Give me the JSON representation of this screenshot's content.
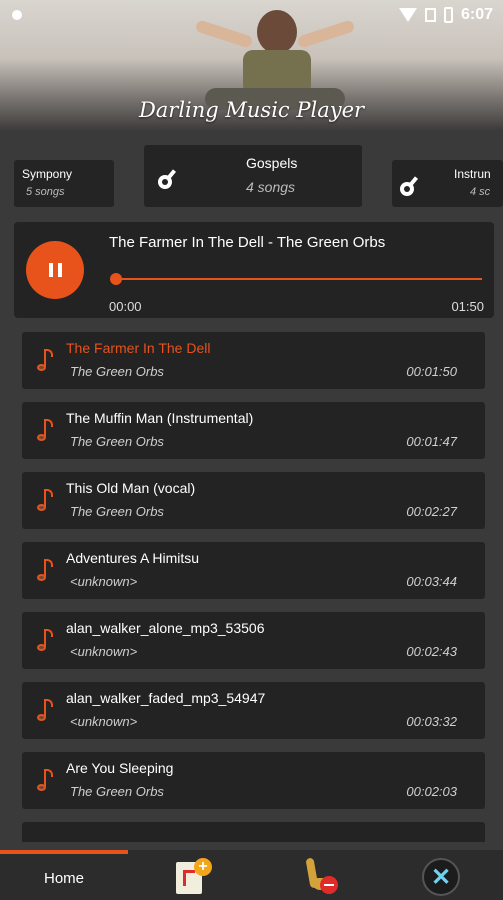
{
  "status_bar": {
    "time": "6:07"
  },
  "header": {
    "app_title": "Darling Music Player"
  },
  "playlists": [
    {
      "name": "Sympony",
      "count": "5 songs"
    },
    {
      "name": "Gospels",
      "count": "4 songs"
    },
    {
      "name": "Instrun",
      "count": "4 sc"
    }
  ],
  "now_playing": {
    "title": "The Farmer In The Dell - The Green Orbs",
    "current_time": "00:00",
    "duration": "01:50",
    "progress": 0.0
  },
  "songs": [
    {
      "title": "The Farmer In The Dell",
      "artist": "The Green Orbs",
      "duration": "00:01:50",
      "active": true
    },
    {
      "title": "The Muffin Man (Instrumental)",
      "artist": "The Green Orbs",
      "duration": "00:01:47"
    },
    {
      "title": "This Old Man (vocal)",
      "artist": "The Green Orbs",
      "duration": "00:02:27"
    },
    {
      "title": "Adventures A Himitsu",
      "artist": "<unknown>",
      "duration": "00:03:44"
    },
    {
      "title": "alan_walker_alone_mp3_53506",
      "artist": "<unknown>",
      "duration": "00:02:43"
    },
    {
      "title": "alan_walker_faded_mp3_54947",
      "artist": "<unknown>",
      "duration": "00:03:32"
    },
    {
      "title": "Are You Sleeping",
      "artist": "The Green Orbs",
      "duration": "00:02:03"
    }
  ],
  "bottom_nav": {
    "home_label": "Home",
    "close_glyph": "✕"
  },
  "colors": {
    "accent": "#e8521b",
    "background": "#3a3a3a",
    "card": "#232323"
  }
}
